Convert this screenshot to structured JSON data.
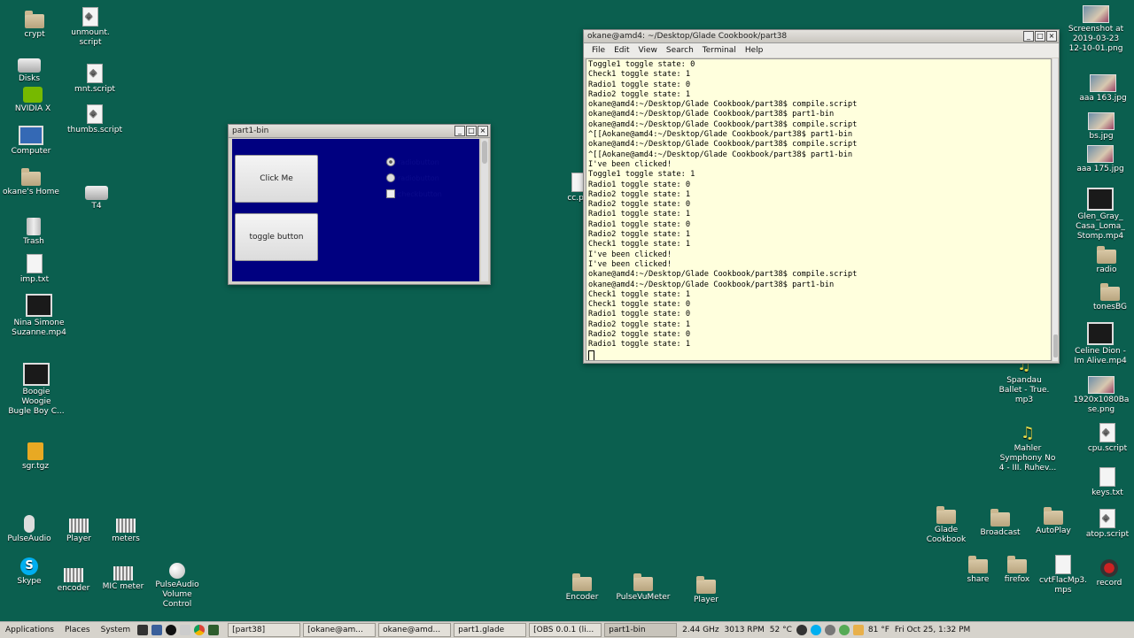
{
  "colors": {
    "desktop": "#0b5f4f",
    "app_bg": "#000080",
    "terminal_bg": "#ffffdd"
  },
  "desktop_icons": [
    {
      "label": "crypt",
      "icon": "folder-icon"
    },
    {
      "label": "unmount.\nscript",
      "icon": "script-icon"
    },
    {
      "label": "Disks",
      "icon": "disks-icon"
    },
    {
      "label": "mnt.script",
      "icon": "script-icon"
    },
    {
      "label": "NVIDIA X",
      "icon": "nvidia-icon"
    },
    {
      "label": "thumbs.script",
      "icon": "script-icon"
    },
    {
      "label": "Computer",
      "icon": "computer-icon"
    },
    {
      "label": "okane's Home",
      "icon": "home-folder-icon"
    },
    {
      "label": "T4",
      "icon": "drive-icon"
    },
    {
      "label": "Trash",
      "icon": "trash-icon"
    },
    {
      "label": "imp.txt",
      "icon": "text-file-icon"
    },
    {
      "label": "Nina Simone\nSuzanne.mp4",
      "icon": "video-icon"
    },
    {
      "label": "Boogie\nWoogie\nBugle Boy C...",
      "icon": "video-icon"
    },
    {
      "label": "sgr.tgz",
      "icon": "archive-icon"
    },
    {
      "label": "PulseAudio",
      "icon": "microphone-icon"
    },
    {
      "label": "Player",
      "icon": "player-icon"
    },
    {
      "label": "meters",
      "icon": "meters-icon"
    },
    {
      "label": "Skype",
      "icon": "skype-icon"
    },
    {
      "label": "encoder",
      "icon": "encoder-icon"
    },
    {
      "label": "MIC meter",
      "icon": "meters-icon"
    },
    {
      "label": "PulseAudio\nVolume\nControl",
      "icon": "volume-icon"
    },
    {
      "label": "Encoder",
      "icon": "folder-icon"
    },
    {
      "label": "PulseVuMeter",
      "icon": "folder-icon"
    },
    {
      "label": "Player",
      "icon": "folder-icon"
    },
    {
      "label": "cc.pdf",
      "icon": "pdf-icon"
    },
    {
      "label": "Screenshot at\n2019-03-23\n12-10-01.png",
      "icon": "image-icon"
    },
    {
      "label": "aaa 163.jpg",
      "icon": "image-icon"
    },
    {
      "label": "bs.jpg",
      "icon": "image-icon"
    },
    {
      "label": "aaa 175.jpg",
      "icon": "image-icon"
    },
    {
      "label": "Glen_Gray_\nCasa_Loma_\nStomp.mp4",
      "icon": "video-icon"
    },
    {
      "label": "radio",
      "icon": "folder-icon"
    },
    {
      "label": "tonesBG",
      "icon": "folder-icon"
    },
    {
      "label": "Celine Dion -\nIm Alive.mp4",
      "icon": "video-icon"
    },
    {
      "label": "Spandau\nBallet - True.\nmp3",
      "icon": "music-icon"
    },
    {
      "label": "1920x1080Ba\nse.png",
      "icon": "image-icon"
    },
    {
      "label": "Mahler\nSymphony No\n4 - III. Ruhev...",
      "icon": "music-icon"
    },
    {
      "label": "cpu.script",
      "icon": "script-icon"
    },
    {
      "label": "keys.txt",
      "icon": "text-file-icon"
    },
    {
      "label": "Glade\nCookbook",
      "icon": "folder-icon"
    },
    {
      "label": "Broadcast",
      "icon": "folder-icon"
    },
    {
      "label": "AutoPlay",
      "icon": "folder-icon"
    },
    {
      "label": "atop.script",
      "icon": "script-icon"
    },
    {
      "label": "share",
      "icon": "folder-icon"
    },
    {
      "label": "firefox",
      "icon": "folder-icon"
    },
    {
      "label": "cvtFlacMp3.\nmps",
      "icon": "text-file-icon"
    },
    {
      "label": "record",
      "icon": "record-icon"
    }
  ],
  "terminal": {
    "title": "okane@amd4: ~/Desktop/Glade Cookbook/part38",
    "menu": [
      "File",
      "Edit",
      "View",
      "Search",
      "Terminal",
      "Help"
    ],
    "lines": [
      "Toggle1 toggle state: 0",
      "Check1 toggle state: 1",
      "Radio1 toggle state: 0",
      "Radio2 toggle state: 1",
      "okane@amd4:~/Desktop/Glade Cookbook/part38$ compile.script",
      "okane@amd4:~/Desktop/Glade Cookbook/part38$ part1-bin",
      "okane@amd4:~/Desktop/Glade Cookbook/part38$ compile.script",
      "^[[Aokane@amd4:~/Desktop/Glade Cookbook/part38$ part1-bin",
      "okane@amd4:~/Desktop/Glade Cookbook/part38$ compile.script",
      "^[[Aokane@amd4:~/Desktop/Glade Cookbook/part38$ part1-bin",
      "I've been clicked!",
      "Toggle1 toggle state: 1",
      "Radio1 toggle state: 0",
      "Radio2 toggle state: 1",
      "Radio2 toggle state: 0",
      "Radio1 toggle state: 1",
      "Radio1 toggle state: 0",
      "Radio2 toggle state: 1",
      "Check1 toggle state: 1",
      "I've been clicked!",
      "I've been clicked!",
      "okane@amd4:~/Desktop/Glade Cookbook/part38$ compile.script",
      "okane@amd4:~/Desktop/Glade Cookbook/part38$ part1-bin",
      "Check1 toggle state: 1",
      "Check1 toggle state: 0",
      "Radio1 toggle state: 0",
      "Radio2 toggle state: 1",
      "Radio2 toggle state: 0",
      "Radio1 toggle state: 1"
    ]
  },
  "app_window": {
    "title": "part1-bin",
    "click_button": "Click Me",
    "toggle_button": "toggle button",
    "radio1": {
      "label": "radiobutton",
      "checked": true
    },
    "radio2": {
      "label": "radiobutton",
      "checked": false
    },
    "check": {
      "label": "checkbutton",
      "checked": false
    }
  },
  "taskbar": {
    "menus": [
      "Applications",
      "Places",
      "System"
    ],
    "tasks": [
      "[part38]",
      "[okane@am...",
      "okane@amd...",
      "part1.glade",
      "[OBS 0.0.1 (li...",
      "part1-bin"
    ],
    "active_task": "part1-bin",
    "cpu": "2.44 GHz",
    "fan": "3013 RPM",
    "temp": "52 °C",
    "weather": "81 °F",
    "clock": "Fri Oct 25, 1:32 PM"
  }
}
